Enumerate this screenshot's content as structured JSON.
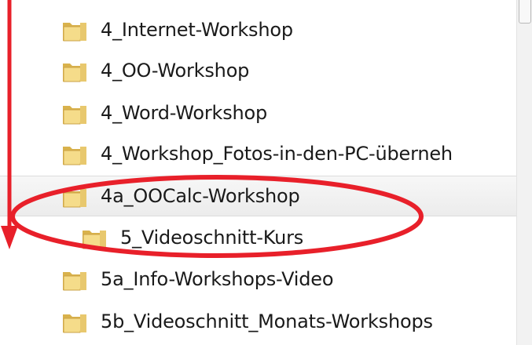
{
  "tree": {
    "items": [
      {
        "label": "4_Internet-Workshop"
      },
      {
        "label": "4_OO-Workshop"
      },
      {
        "label": "4_Word-Workshop"
      },
      {
        "label": "4_Workshop_Fotos-in-den-PC-überneh"
      },
      {
        "label": "4a_OOCalc-Workshop",
        "selected": true
      },
      {
        "label": "5_Videoschnitt-Kurs"
      },
      {
        "label": "5a_Info-Workshops-Video"
      },
      {
        "label": "5b_Videoschnitt_Monats-Workshops"
      }
    ]
  },
  "colors": {
    "annotation": "#e8202a",
    "folder_light": "#f5dc8a",
    "folder_dark": "#d9b24c",
    "selection": "#ececec"
  },
  "icons": {
    "folder": "folder-icon"
  }
}
